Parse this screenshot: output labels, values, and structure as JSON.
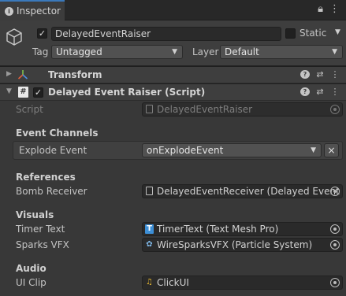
{
  "tab": {
    "label": "Inspector"
  },
  "header": {
    "object_name": "DelayedEventRaiser",
    "static_label": "Static",
    "tag_label": "Tag",
    "tag_value": "Untagged",
    "layer_label": "Layer",
    "layer_value": "Default"
  },
  "transform": {
    "title": "Transform"
  },
  "component": {
    "title": "Delayed Event Raiser (Script)",
    "script_label": "Script",
    "script_value": "DelayedEventRaiser"
  },
  "event_channels": {
    "header": "Event Channels",
    "explode_label": "Explode Event",
    "explode_value": "onExplodeEvent",
    "clear_label": "×"
  },
  "references": {
    "header": "References",
    "bomb_label": "Bomb Receiver",
    "bomb_value": "DelayedEventReceiver (Delayed Event"
  },
  "visuals": {
    "header": "Visuals",
    "timer_label": "Timer Text",
    "timer_value": "TimerText (Text Mesh Pro)",
    "sparks_label": "Sparks VFX",
    "sparks_value": "WireSparksVFX (Particle System)"
  },
  "audio": {
    "header": "Audio",
    "clip_label": "UI Clip",
    "clip_value": "ClickUI"
  }
}
